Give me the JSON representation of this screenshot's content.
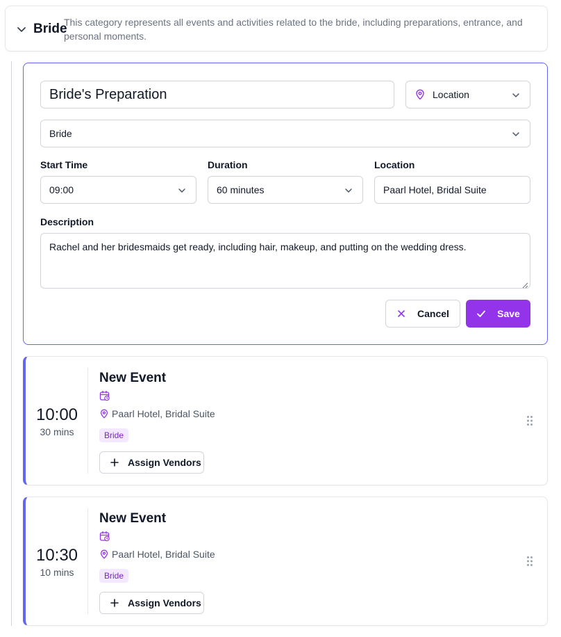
{
  "category": {
    "name": "Bride",
    "description": "This category represents all events and activities related to the bride, including preparations, entrance, and personal moments."
  },
  "edit_form": {
    "title_value": "Bride's Preparation",
    "location_select": "Location",
    "category_value": "Bride",
    "start_time_label": "Start Time",
    "start_time_value": "09:00",
    "duration_label": "Duration",
    "duration_value": "60 minutes",
    "location_label": "Location",
    "location_value": "Paarl Hotel, Bridal Suite",
    "description_label": "Description",
    "description_value": "Rachel and her bridesmaids get ready, including hair, makeup, and putting on the wedding dress.",
    "cancel_label": "Cancel",
    "save_label": "Save"
  },
  "events": [
    {
      "time": "10:00",
      "duration": "30 mins",
      "title": "New Event",
      "location": "Paarl Hotel, Bridal Suite",
      "tag": "Bride",
      "assign_label": "Assign Vendors"
    },
    {
      "time": "10:30",
      "duration": "10 mins",
      "title": "New Event",
      "location": "Paarl Hotel, Bridal Suite",
      "tag": "Bride",
      "assign_label": "Assign Vendors"
    }
  ],
  "colors": {
    "accent": "#9333ea",
    "border_accent": "#6366f1",
    "badge_bg": "#f3e8ff",
    "badge_text": "#7e22ce"
  },
  "icons": [
    "chevron-down-icon",
    "map-pin-icon",
    "calendar-clock-icon",
    "x-icon",
    "check-icon",
    "plus-icon",
    "drag-handle-icon"
  ]
}
